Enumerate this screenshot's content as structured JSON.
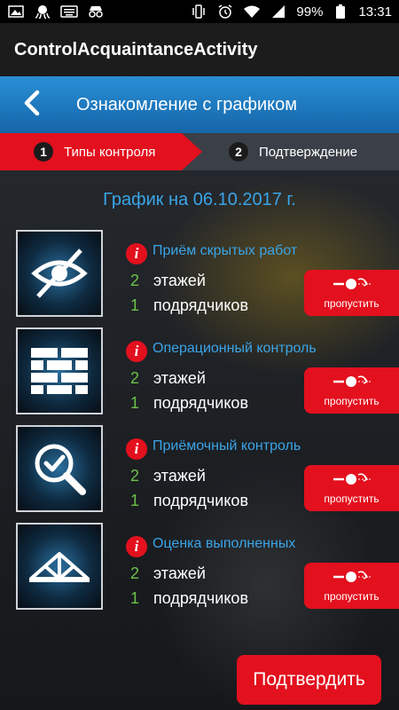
{
  "status_bar": {
    "battery": "99%",
    "time": "13:31",
    "icons_left": [
      "image-icon",
      "octopus-icon",
      "keyboard-icon",
      "incognito-icon"
    ],
    "icons_right": [
      "vibrate-icon",
      "alarm-icon",
      "wifi-icon",
      "signal-icon",
      "battery-icon"
    ]
  },
  "app": {
    "title": "ControlAcquaintanceActivity"
  },
  "header": {
    "title": "Ознакомление с графиком"
  },
  "steps": [
    {
      "number": "1",
      "label": "Типы контроля",
      "active": true
    },
    {
      "number": "2",
      "label": "Подтверждение",
      "active": false
    }
  ],
  "schedule_title": "График на 06.10.2017 г.",
  "items": [
    {
      "icon": "hidden-eye-icon",
      "title": "Приём скрытых работ",
      "floors_count": "2",
      "floors_label": "этажей",
      "contractors_count": "1",
      "contractors_label": "подрядчиков",
      "skip_label": "пропустить"
    },
    {
      "icon": "brick-wall-icon",
      "title": "Операционный контроль",
      "floors_count": "2",
      "floors_label": "этажей",
      "contractors_count": "1",
      "contractors_label": "подрядчиков",
      "skip_label": "пропустить"
    },
    {
      "icon": "magnifier-check-icon",
      "title": "Приёмочный контроль",
      "floors_count": "2",
      "floors_label": "этажей",
      "contractors_count": "1",
      "contractors_label": "подрядчиков",
      "skip_label": "пропустить"
    },
    {
      "icon": "roof-truss-icon",
      "title": "Оценка выполненных",
      "floors_count": "2",
      "floors_label": "этажей",
      "contractors_count": "1",
      "contractors_label": "подрядчиков",
      "skip_label": "пропустить"
    }
  ],
  "confirm_label": "Подтвердить",
  "colors": {
    "accent_red": "#e3101e",
    "accent_blue": "#3aa5e8",
    "count_green": "#6cc24a",
    "header_blue": "#1f7fc4"
  }
}
